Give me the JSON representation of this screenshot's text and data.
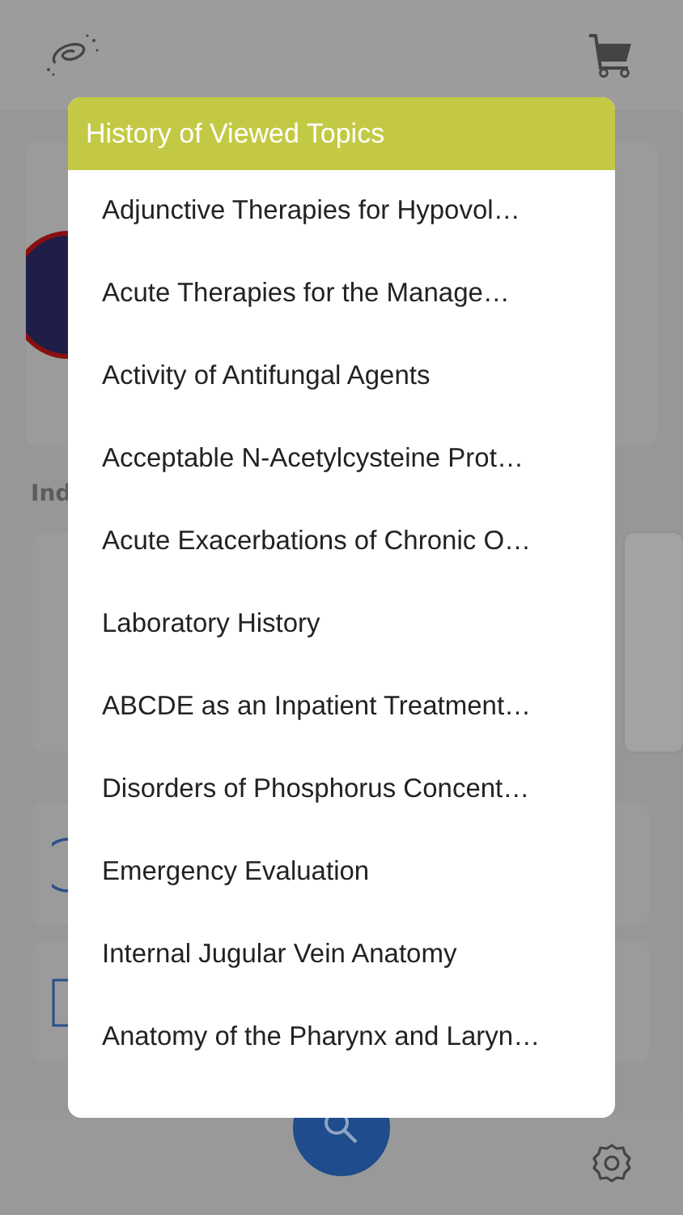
{
  "background": {
    "section_label": "Ind"
  },
  "history": {
    "title": "History of Viewed Topics",
    "topics": [
      "Adjunctive Therapies for Hypovol…",
      "Acute Therapies for the Manage…",
      "Activity of Antifungal Agents",
      "Acceptable N-Acetylcysteine Prot…",
      "Acute Exacerbations of Chronic O…",
      "Laboratory History",
      "ABCDE as an Inpatient Treatment…",
      "Disorders of Phosphorus Concent…",
      "Emergency Evaluation",
      "Internal Jugular Vein Anatomy",
      "Anatomy of the Pharynx and Laryn…"
    ]
  }
}
